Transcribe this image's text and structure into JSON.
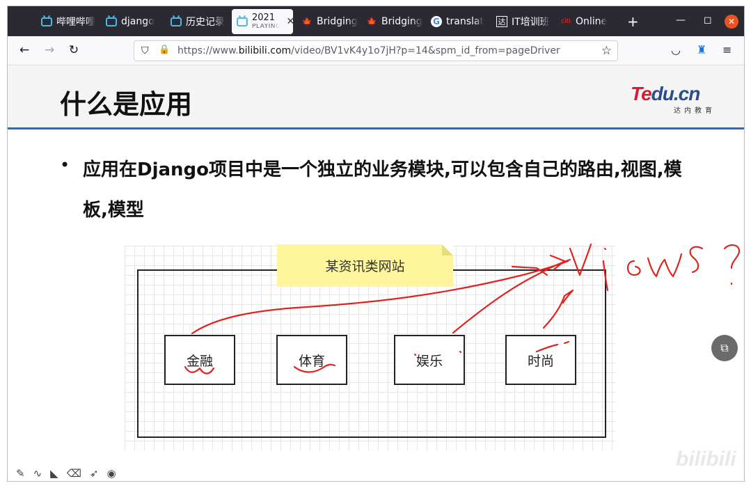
{
  "browser": {
    "tabs": [
      {
        "label": "哔哩哔哩",
        "icon": "bilibili-icon"
      },
      {
        "label": "django",
        "icon": "bilibili-icon"
      },
      {
        "label": "历史记录",
        "icon": "bilibili-icon"
      },
      {
        "label": "2021",
        "sub": "PLAYING",
        "icon": "bilibili-icon",
        "active": true
      },
      {
        "label": "Bridging",
        "icon": "maple-leaf-icon"
      },
      {
        "label": "Bridging",
        "icon": "maple-leaf-icon"
      },
      {
        "label": "translat",
        "icon": "google-icon"
      },
      {
        "label": "IT培训班",
        "icon": "tarena-icon"
      },
      {
        "label": "Online",
        "icon": "citi-icon"
      }
    ],
    "url_prefix": "https://www.",
    "url_domain": "bilibili.com",
    "url_path": "/video/BV1vK4y1o7jH?p=14&spm_id_from=pageDriver"
  },
  "slide": {
    "title": "什么是应用",
    "logo_brand_a": "Te",
    "logo_brand_b": "du.cn",
    "logo_sub": "达内教育",
    "bullet_text": "应用在Django项目中是一个独立的业务模块,可以包含自己的路由,视图,模板,模型",
    "note_label": "某资讯类网站",
    "boxes": [
      "金融",
      "体育",
      "娱乐",
      "时尚"
    ],
    "handwriting": "views ?"
  },
  "player": {
    "watermark": "bilibili"
  },
  "colors": {
    "tab_bar": "#2b2a33",
    "divider": "#2a6db0",
    "note": "#fff59d",
    "ink": "#e0231c"
  }
}
